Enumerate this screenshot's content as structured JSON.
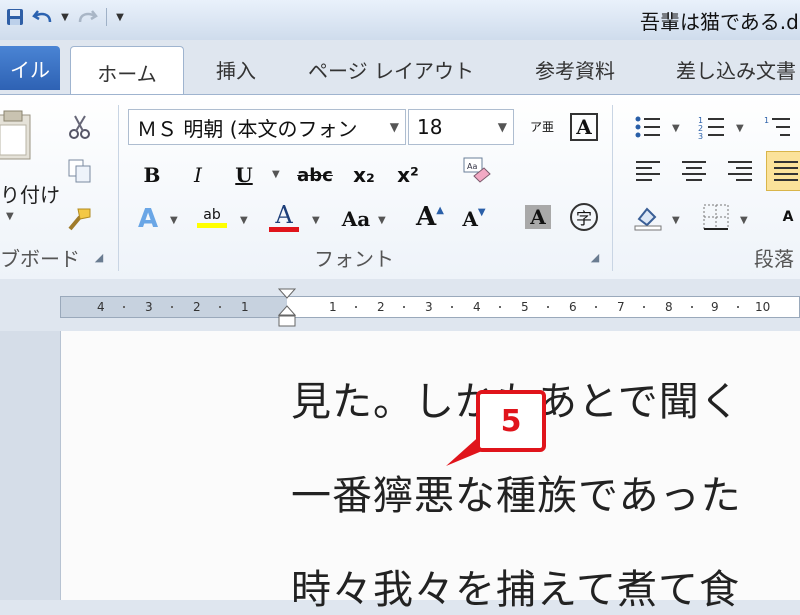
{
  "quick_access": {
    "save": "save-icon",
    "undo": "undo-icon",
    "redo": "redo-icon",
    "customize": "customize-icon"
  },
  "title": {
    "document": "吾輩は猫である.d"
  },
  "tabs": {
    "file": "イル",
    "home": "ホーム",
    "insert": "挿入",
    "page_layout": "ページ レイアウト",
    "references": "参考資料",
    "mailings": "差し込み文書"
  },
  "clipboard": {
    "paste_label": "り付け",
    "group_label": "ブボード"
  },
  "font": {
    "font_name": "ＭＳ 明朝 (本文のフォン",
    "font_size": "18",
    "bold": "B",
    "italic": "I",
    "underline": "U",
    "strike": "abc",
    "subscript": "x₂",
    "superscript": "x²",
    "highlight": "ab",
    "font_color": "A",
    "change_case": "Aa",
    "grow": "A",
    "shrink": "A",
    "char_shading": "A",
    "enclose": "字",
    "phonetic": "ア亜",
    "char_border": "A",
    "group_label": "フォント"
  },
  "paragraph": {
    "group_label": "段落"
  },
  "ruler": {
    "ticks": [
      "4",
      "3",
      "2",
      "1",
      "1",
      "2",
      "3",
      "4",
      "5",
      "6",
      "7",
      "8",
      "9",
      "10"
    ]
  },
  "document": {
    "lines": [
      "見た。しかもあとで聞く",
      "一番獰悪な種族であった",
      "時々我々を捕えて煮て食"
    ]
  },
  "callout": {
    "label": "5"
  },
  "colors": {
    "accent": "#2e62b4",
    "callout_red": "#e0141b",
    "highlight_yellow": "#ffff00",
    "font_red": "#e0141b"
  }
}
